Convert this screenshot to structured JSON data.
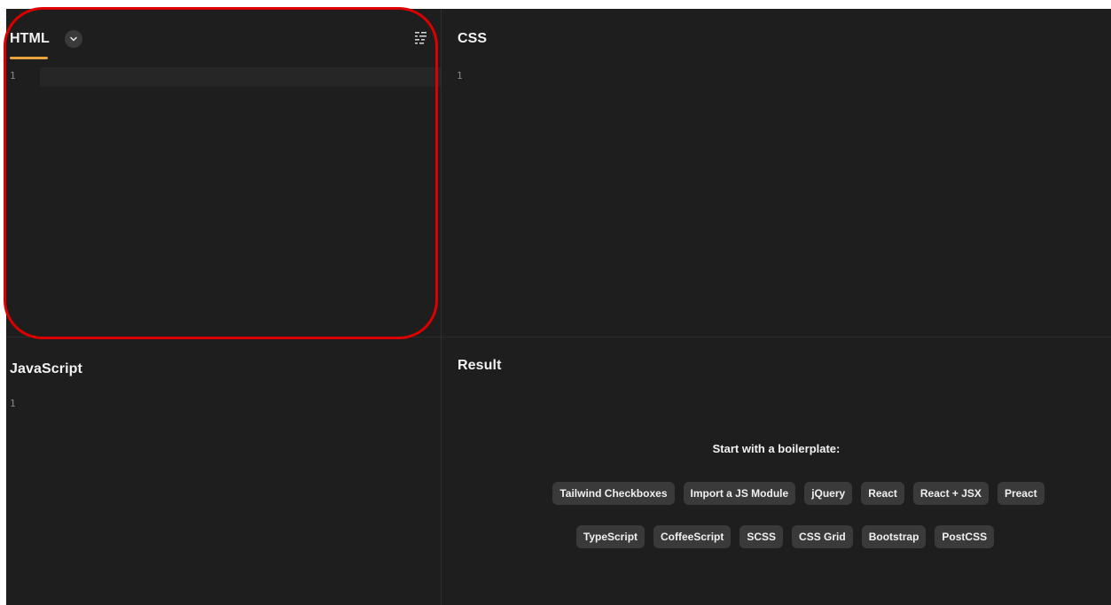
{
  "editors": {
    "html": {
      "title": "HTML",
      "line_number": "1"
    },
    "css": {
      "title": "CSS",
      "line_number": "1"
    },
    "js": {
      "title": "JavaScript",
      "line_number": "1"
    }
  },
  "result": {
    "title": "Result",
    "boilerplate_heading": "Start with a boilerplate:",
    "boilerplates_row1": [
      "Tailwind Checkboxes",
      "Import a JS Module",
      "jQuery",
      "React",
      "React + JSX",
      "Preact"
    ],
    "boilerplates_row2": [
      "TypeScript",
      "CoffeeScript",
      "SCSS",
      "CSS Grid",
      "Bootstrap",
      "PostCSS"
    ]
  },
  "colors": {
    "background": "#1e1e1e",
    "active_tab_underline": "#e8a33d",
    "chip_background": "#3a3a3a",
    "annotation_ring": "#dd0000"
  },
  "icons": {
    "html_dropdown": "chevron-down-icon",
    "html_format": "format-code-icon"
  }
}
